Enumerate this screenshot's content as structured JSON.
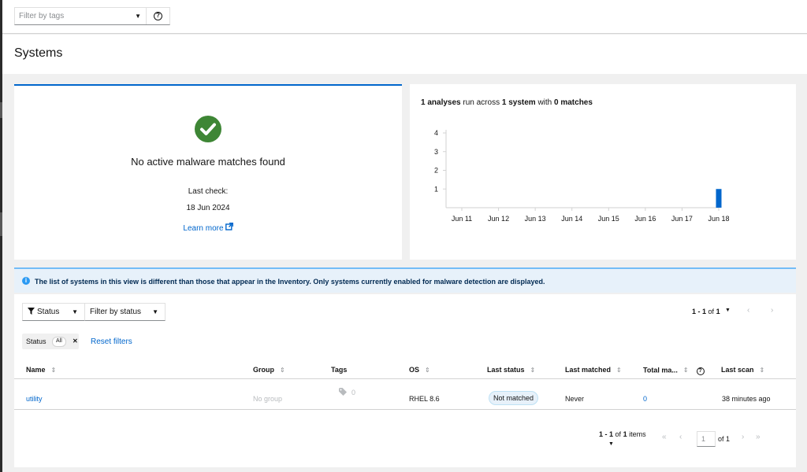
{
  "filter": {
    "placeholder": "Filter by tags",
    "help_icon": "question-circle-icon"
  },
  "page": {
    "title": "Systems"
  },
  "summary_card": {
    "status_icon": "check-circle-icon",
    "heading": "No active malware matches found",
    "last_check_label": "Last check:",
    "last_check_date": "18 Jun 2024",
    "learn_more": "Learn more",
    "colors": {
      "accent": "#0066cc",
      "success": "#3e8635"
    }
  },
  "chart_card": {
    "title_parts": {
      "analyses": "1 analyses",
      "mid1": " run across ",
      "systems": "1 system",
      "mid2": " with ",
      "matches": "0 matches"
    }
  },
  "chart_data": {
    "type": "bar",
    "categories": [
      "Jun 11",
      "Jun 12",
      "Jun 13",
      "Jun 14",
      "Jun 15",
      "Jun 16",
      "Jun 17",
      "Jun 18"
    ],
    "values": [
      0,
      0,
      0,
      0,
      0,
      0,
      0,
      1
    ],
    "yticks": [
      1,
      2,
      3,
      4
    ],
    "ylim": [
      0,
      4
    ],
    "color": "#0066cc",
    "grid": false
  },
  "alert": {
    "message": "The list of systems in this view is different than those that appear in the Inventory. Only systems currently enabled for malware detection are displayed."
  },
  "toolbar": {
    "status_dropdown": "Status",
    "filter_dropdown": "Filter by status",
    "pagination_top": {
      "range": "1 - 1",
      "of_label": "of",
      "total": "1"
    },
    "chip": {
      "category": "Status",
      "value": "All"
    },
    "reset_filters": "Reset filters"
  },
  "table": {
    "columns": [
      "Name",
      "Group",
      "Tags",
      "OS",
      "Last status",
      "Last matched",
      "Total ma...",
      "Last scan"
    ],
    "rows": [
      {
        "name": "utility",
        "group": "No group",
        "tags": "0",
        "os": "RHEL 8.6",
        "last_status": "Not matched",
        "last_matched": "Never",
        "total_matches": "0",
        "last_scan": "38 minutes ago"
      }
    ]
  },
  "pagination_bottom": {
    "range": "1 - 1",
    "of_label": "of",
    "total": "1",
    "items_label": "items",
    "page_value": "1",
    "page_of": "of 1"
  }
}
